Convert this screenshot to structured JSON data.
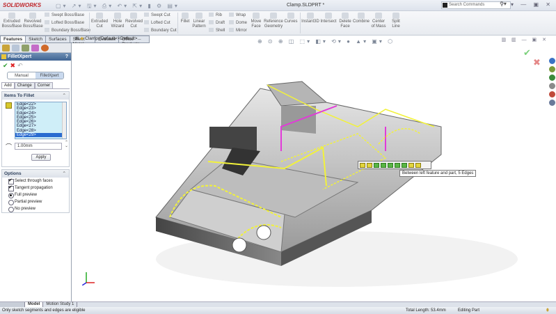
{
  "app": {
    "logo": "SOLIDWORKS",
    "doc_title": "Clamp.SLDPRT *",
    "search_placeholder": "Search Commands"
  },
  "ribbon": {
    "buttons": [
      "Extruded Boss/Base",
      "Revolved Boss/Base",
      "Extruded Cut",
      "Hole Wizard",
      "Revolved Cut",
      "Fillet",
      "Linear Pattern",
      "Move Face",
      "Reference Geometry",
      "Curves",
      "Instant3D",
      "Intersect",
      "Delete Face",
      "Combine",
      "Center of Mass",
      "Split Line"
    ],
    "small": [
      "Swept Boss/Base",
      "Lofted Boss/Base",
      "Boundary Boss/Base",
      "Swept Cut",
      "Lofted Cut",
      "Boundary Cut",
      "Rib",
      "Draft",
      "Shell",
      "Wrap",
      "Dome",
      "Mirror"
    ]
  },
  "command_tabs": [
    "Features",
    "Sketch",
    "Surfaces",
    "Sheet Metal",
    "Evaluate",
    "Office Products"
  ],
  "property_manager": {
    "title": "FilletXpert",
    "help": "?",
    "modes": [
      "Manual",
      "FilletXpert"
    ],
    "tabs": [
      "Add",
      "Change",
      "Corner"
    ],
    "items_group": "Items To Fillet",
    "edges": [
      "Edge<22>",
      "Edge<23>",
      "Edge<24>",
      "Edge<25>",
      "Edge<26>",
      "Edge<27>",
      "Edge<28>",
      "Edge<29>"
    ],
    "radius": "1.00mm",
    "apply": "Apply",
    "options_group": "Options",
    "options": [
      {
        "label": "Select through faces",
        "type": "checkbox",
        "checked": true
      },
      {
        "label": "Tangent propagation",
        "type": "checkbox",
        "checked": true
      },
      {
        "label": "Full preview",
        "type": "radio",
        "checked": true
      },
      {
        "label": "Partial preview",
        "type": "radio",
        "checked": false
      },
      {
        "label": "No preview",
        "type": "radio",
        "checked": false
      }
    ]
  },
  "viewport": {
    "tree_item": "Clamp  (Default<<Default>..."
  },
  "tooltip": "Between left feature and part, 5 Edges",
  "bottom_tabs": [
    "Model",
    "Motion Study 1"
  ],
  "status": {
    "message": "Only sketch segments and edges are eligible",
    "length": "Total Length: 53.4mm",
    "mode": "Editing Part"
  },
  "colors": {
    "preview_yellow": "#f2f23a",
    "selection_magenta": "#e23ad8",
    "header_blue": "#3f6493"
  }
}
